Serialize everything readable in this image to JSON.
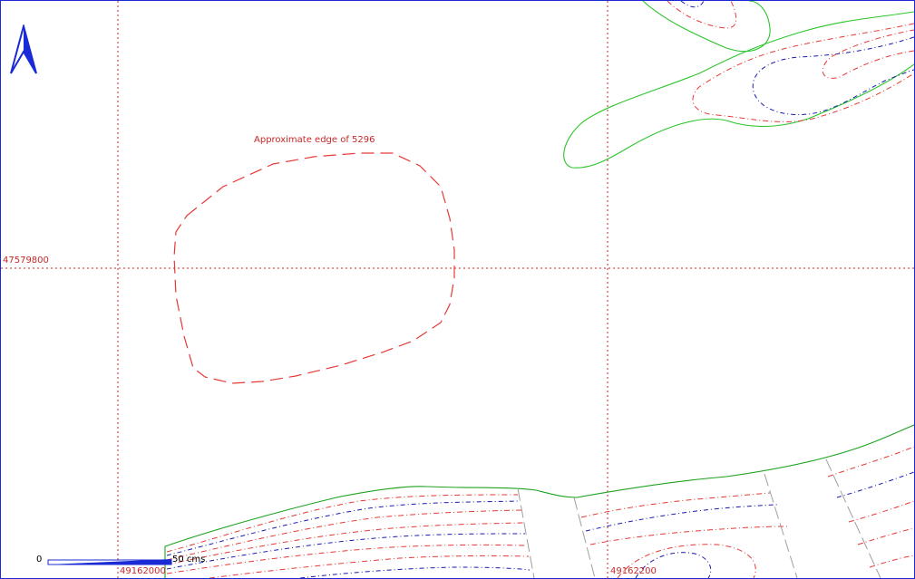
{
  "map": {
    "annotation": "Approximate edge of 5296",
    "grid": {
      "northing_label": "47579800",
      "easting_labels": [
        "49162000",
        "49162200"
      ]
    },
    "scale": {
      "start_label": "0",
      "end_label": "50 cms"
    },
    "colors": {
      "frame": "#1a2bd6",
      "grid": "#c62828",
      "edge": "#e53935",
      "boundary": "#2bc52b",
      "contour_blue": "#1a1ab0",
      "contour_red": "#e53935",
      "hachure": "#9e9e9e",
      "north_arrow": "#1a2bd6"
    },
    "icons": [
      "north-arrow-icon",
      "scale-bar-icon"
    ]
  }
}
